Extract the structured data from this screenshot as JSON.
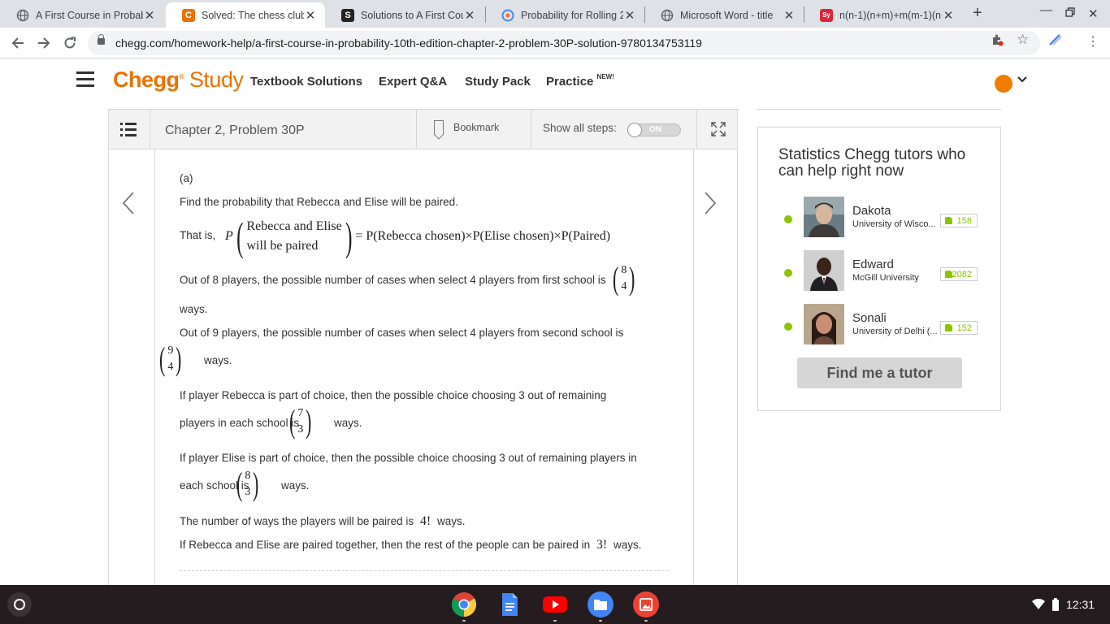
{
  "browser": {
    "tabs": [
      {
        "title": "A First Course in Probab",
        "favicon": "globe-icon",
        "active": false
      },
      {
        "title": "Solved: The chess clubs",
        "favicon": "chegg-icon",
        "active": true
      },
      {
        "title": "Solutions to A First Cour",
        "favicon": "slader-icon",
        "active": false
      },
      {
        "title": "Probability for Rolling 2",
        "favicon": "site-icon",
        "active": false
      },
      {
        "title": "Microsoft Word - title",
        "favicon": "globe-icon",
        "active": false
      },
      {
        "title": "n(n-1)(n+m)+m(m-1)(n+",
        "favicon": "symbolab-icon",
        "favicon_text": "Sy",
        "active": false
      }
    ],
    "url": "chegg.com/homework-help/a-first-course-in-probability-10th-edition-chapter-2-problem-30P-solution-9780134753119"
  },
  "header": {
    "logo_brand": "Chegg",
    "logo_product": "Study",
    "nav": [
      {
        "label": "Textbook Solutions"
      },
      {
        "label": "Expert Q&A"
      },
      {
        "label": "Study Pack"
      },
      {
        "label": "Practice",
        "badge": "NEW!"
      }
    ]
  },
  "problem_bar": {
    "title": "Chapter 2, Problem 30P",
    "bookmark_label": "Bookmark",
    "show_steps_label": "Show all steps:",
    "toggle_label": "ON"
  },
  "solution": {
    "part": "(a)",
    "intro": "Find the probability that Rebecca and Elise will be paired.",
    "that_is": "That is,",
    "formula": {
      "p": "P",
      "top": "Rebecca and Elise",
      "bottom": "will be paired",
      "rhs": "= P(Rebecca chosen)×P(Elise chosen)×P(Paired)"
    },
    "step1_text": "Out of 8 players, the possible number of cases when select 4 players from first school is",
    "step1_binom": [
      "8",
      "4"
    ],
    "step1_tail": "ways.",
    "step2_text": "Out of 9 players, the possible number of cases when select 4 players from second school is",
    "step2_binom": [
      "9",
      "4"
    ],
    "step2_tail": "ways.",
    "step3_line1": "If player Rebecca is part of choice, then the possible choice choosing 3 out of remaining",
    "step3_line2": "players in each school is",
    "step3_binom": [
      "7",
      "3"
    ],
    "step3_tail": "ways.",
    "step4_line1": "If player Elise is part of choice, then the possible choice choosing 3 out of remaining players in",
    "step4_line2": "each school is",
    "step4_binom": [
      "8",
      "3"
    ],
    "step4_tail": "ways.",
    "step5_text": "The number of ways the players will be paired is",
    "step5_value": "4!",
    "step5_tail": "ways.",
    "step6_text": "If Rebecca and Elise are paired together, then the rest of the people can be paired in",
    "step6_value": "3!",
    "step6_tail": "ways."
  },
  "sidebar": {
    "heading": "Statistics Chegg tutors who can help right now",
    "tutors": [
      {
        "name": "Dakota",
        "school": "University of Wisco...",
        "rating": "158",
        "online": true
      },
      {
        "name": "Edward",
        "school": "McGill University",
        "rating": "2082",
        "online": true
      },
      {
        "name": "Sonali",
        "school": "University of Delhi (...",
        "rating": "152",
        "online": true
      }
    ],
    "cta": "Find me a tutor"
  },
  "shelf": {
    "apps": [
      "chrome-icon",
      "docs-icon",
      "youtube-icon",
      "files-icon",
      "gallery-icon"
    ],
    "time": "12:31"
  },
  "colors": {
    "chegg_orange": "#eb7100",
    "online_green": "#8bc400",
    "shelf_bg": "#241c1e"
  }
}
